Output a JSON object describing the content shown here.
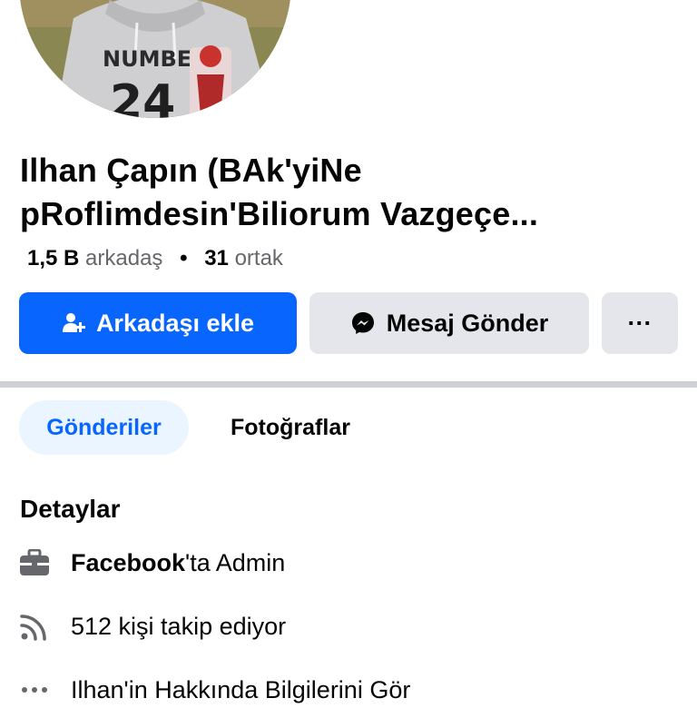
{
  "profile": {
    "name_line1": "Ilhan Çapın (BAk'yiNe",
    "name_line2": "pRoflimdesin'Biliorum Vazgeçe...",
    "friends_count": "1,5 B",
    "friends_label": "arkadaş",
    "separator": "•",
    "mutual_count": "31",
    "mutual_label": "ortak",
    "avatar_shirt_text": "NUMBER"
  },
  "actions": {
    "add_friend_label": "Arkadaşı ekle",
    "message_label": "Mesaj Gönder",
    "more_label": "···"
  },
  "tabs": [
    {
      "label": "Gönderiler",
      "active": true
    },
    {
      "label": "Fotoğraflar",
      "active": false
    }
  ],
  "details": {
    "title": "Detaylar",
    "work_bold": "Facebook",
    "work_rest": "'ta Admin",
    "followers": "512 kişi takip ediyor",
    "about": "Ilhan'in Hakkında Bilgilerini Gör"
  },
  "icons": [
    "add-friend-icon",
    "messenger-icon",
    "more-icon",
    "briefcase-icon",
    "rss-icon",
    "ellipsis-icon"
  ],
  "colors": {
    "primary": "#0866ff",
    "secondary_button": "#e4e6eb",
    "active_tab_bg": "#ebf5ff",
    "divider": "#ced0d4",
    "muted_text": "#65676b"
  }
}
